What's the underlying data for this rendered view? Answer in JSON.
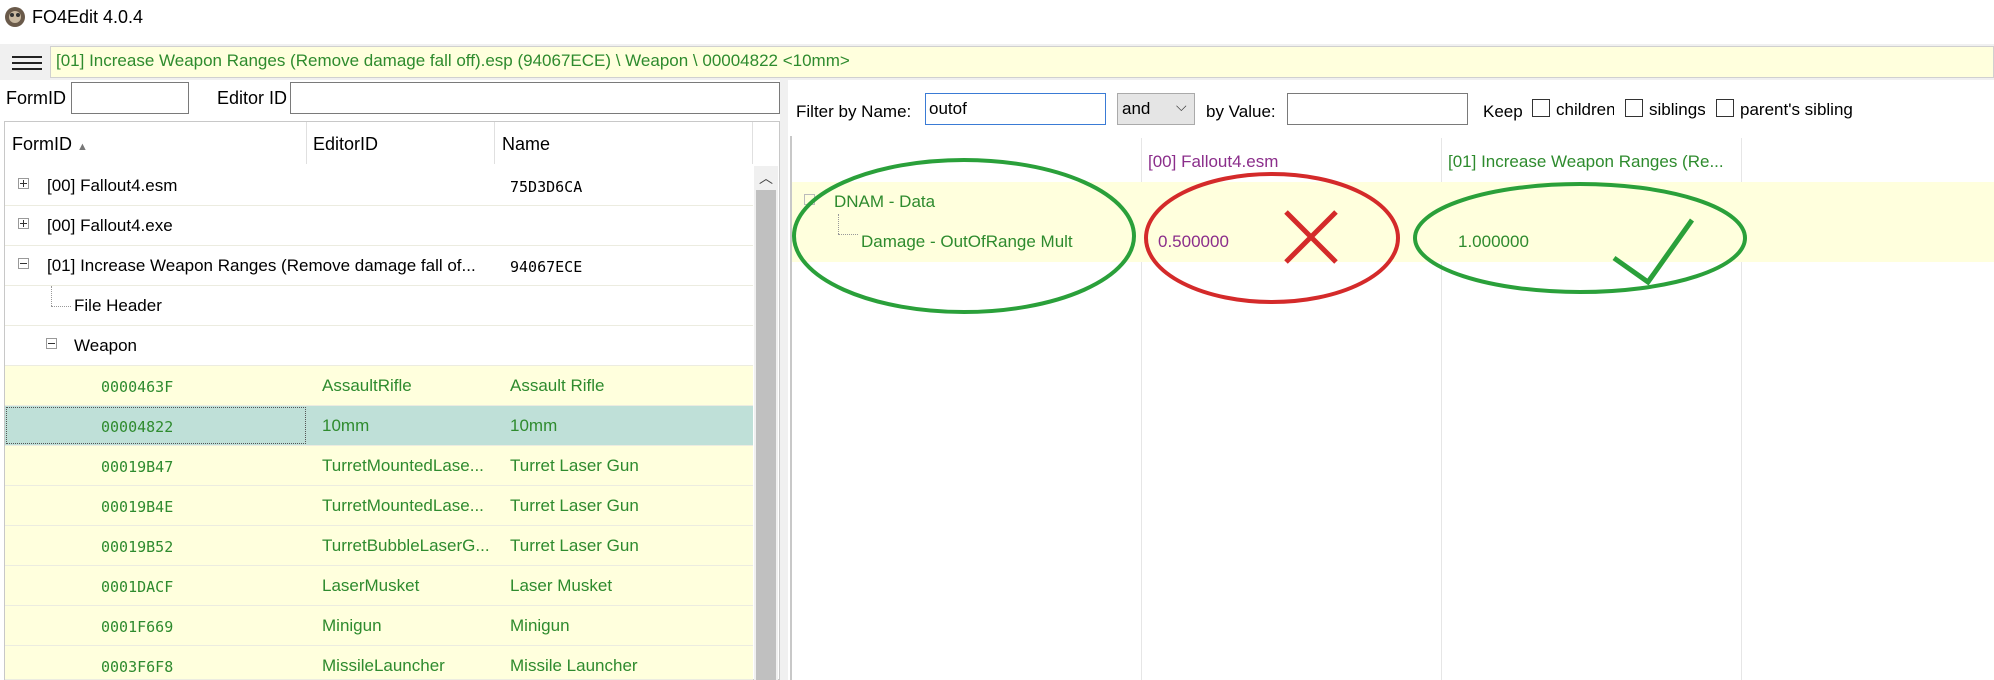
{
  "window": {
    "title": "FO4Edit 4.0.4"
  },
  "pathbar": {
    "text": "[01] Increase Weapon Ranges (Remove damage fall off).esp (94067ECE) \\ Weapon \\ 00004822 <10mm>"
  },
  "search": {
    "formid_label": "FormID",
    "formid_value": "",
    "editorid_label": "Editor ID",
    "editorid_value": ""
  },
  "tree": {
    "columns": [
      "FormID",
      "EditorID",
      "Name"
    ],
    "rows": [
      {
        "formid": "[00] Fallout4.esm",
        "editorid": "",
        "name": "75D3D6CA"
      },
      {
        "formid": "[00] Fallout4.exe",
        "editorid": "",
        "name": ""
      },
      {
        "formid": "[01] Increase Weapon Ranges (Remove damage fall of...",
        "editorid": "",
        "name": "94067ECE"
      },
      {
        "formid": "File Header",
        "editorid": "",
        "name": ""
      },
      {
        "formid": "Weapon",
        "editorid": "",
        "name": ""
      },
      {
        "formid": "0000463F",
        "editorid": "AssaultRifle",
        "name": "Assault Rifle"
      },
      {
        "formid": "00004822",
        "editorid": "10mm",
        "name": "10mm"
      },
      {
        "formid": "00019B47",
        "editorid": "TurretMountedLase...",
        "name": "Turret Laser Gun"
      },
      {
        "formid": "00019B4E",
        "editorid": "TurretMountedLase...",
        "name": "Turret Laser Gun"
      },
      {
        "formid": "00019B52",
        "editorid": "TurretBubbleLaserG...",
        "name": "Turret Laser Gun"
      },
      {
        "formid": "0001DACF",
        "editorid": "LaserMusket",
        "name": "Laser Musket"
      },
      {
        "formid": "0001F669",
        "editorid": "Minigun",
        "name": "Minigun"
      },
      {
        "formid": "0003F6F8",
        "editorid": "MissileLauncher",
        "name": "Missile Launcher"
      }
    ]
  },
  "filter": {
    "name_label": "Filter by Name:",
    "name_value": "outof",
    "operator": "and",
    "value_label": "by Value:",
    "value_value": "",
    "keep_label": "Keep",
    "children_label": "children",
    "siblings_label": "siblings",
    "parent_sibling_label": "parent's sibling"
  },
  "compare": {
    "col1_header": "[00] Fallout4.esm",
    "col2_header": "[01] Increase Weapon Ranges (Re...",
    "group_label": "DNAM - Data",
    "field_label": "Damage - OutOfRange Mult",
    "value1": "0.500000",
    "value2": "1.000000"
  },
  "colors": {
    "green": "#2e8b2e",
    "purple": "#8b2e8b",
    "highlight": "#ffffdd",
    "selection": "#bfe0d8",
    "red_annotation": "#d42a2a",
    "green_annotation": "#2aa03a"
  }
}
